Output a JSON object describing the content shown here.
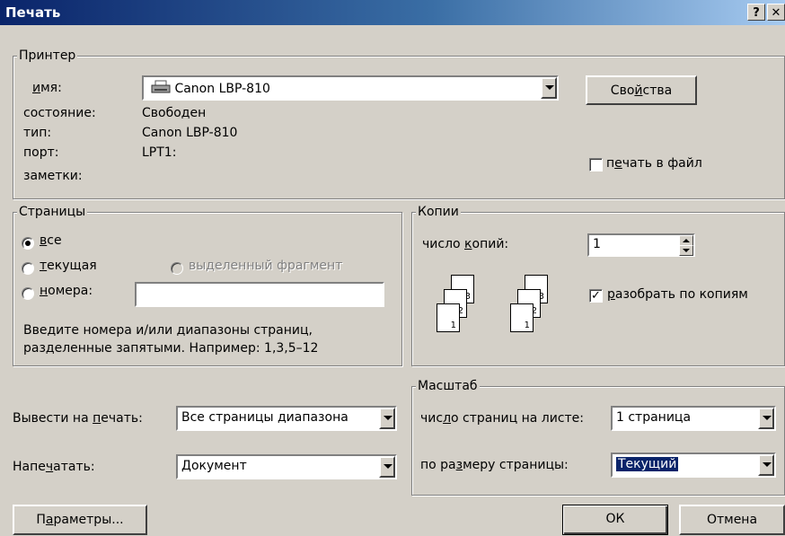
{
  "window": {
    "title": "Печать",
    "help_btn": "?",
    "close_btn": "✕"
  },
  "printer": {
    "group_label": "Принтер",
    "name_label_u": "и",
    "name_label_rest": "мя:",
    "name_value": "Canon LBP-810",
    "properties_pre": "Сво",
    "properties_u": "й",
    "properties_post": "ства",
    "status_label": "состояние:",
    "status_value": "Свободен",
    "type_label": "тип:",
    "type_value": "Canon LBP-810",
    "port_label": "порт:",
    "port_value": "LPT1:",
    "notes_label": "заметки:",
    "print_to_file_pre": "п",
    "print_to_file_u": "е",
    "print_to_file_post": "чать в файл",
    "print_to_file_checked": false
  },
  "pages": {
    "group_label": "Страницы",
    "all_u": "в",
    "all_rest": "се",
    "current_u": "т",
    "current_rest": "екущая",
    "selection": "выделенный фрагмент",
    "numbers_u": "н",
    "numbers_rest": "омера:",
    "numbers_value": "",
    "hint_line1": "Введите номера и/или диапазоны страниц,",
    "hint_line2": "разделенные запятыми. Например: 1,3,5–12"
  },
  "copies": {
    "group_label": "Копии",
    "count_pre": "число ",
    "count_u": "к",
    "count_post": "опий:",
    "count_value": "1",
    "collate_u": "р",
    "collate_rest": "азобрать по копиям",
    "collate_checked": true,
    "page_nums": [
      "3",
      "2",
      "1"
    ]
  },
  "print_what": {
    "label_pre": "Вывести на ",
    "label_u": "п",
    "label_post": "ечать:",
    "value": "Все страницы диапазона"
  },
  "print": {
    "label_pre": "Напе",
    "label_u": "ч",
    "label_post": "атать:",
    "value": "Документ"
  },
  "zoom": {
    "group_label": "Масштаб",
    "pps_pre": "чис",
    "pps_u": "л",
    "pps_post": "о страниц на листе:",
    "pps_value": "1 страница",
    "scale_pre": "по ра",
    "scale_u": "з",
    "scale_post": "меру страницы:",
    "scale_value": "Текущий"
  },
  "buttons": {
    "options_pre": "П",
    "options_u": "а",
    "options_post": "раметры...",
    "ok": "ОК",
    "cancel": "Отмена"
  },
  "colors": {
    "title_start": "#0a246a",
    "title_end": "#a6caf0",
    "face": "#d4d0c8"
  },
  "icons": {
    "printer": "printer-icon"
  }
}
